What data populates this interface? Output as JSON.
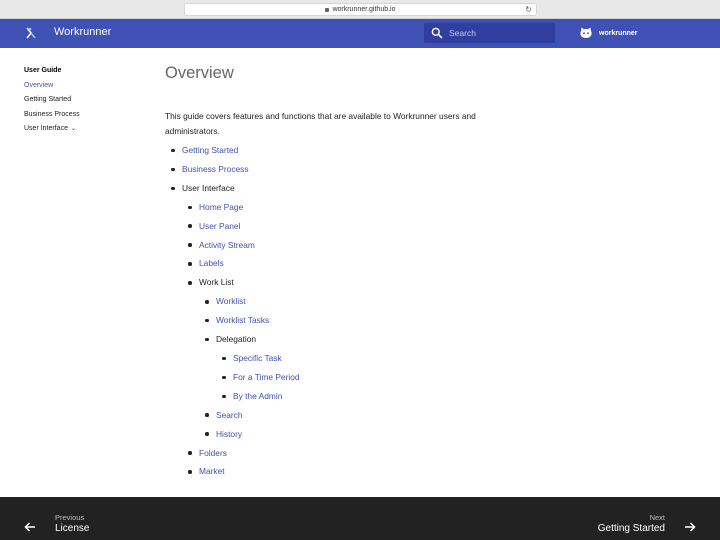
{
  "browser": {
    "url": "workrunner.github.io"
  },
  "header": {
    "title": "Workrunner",
    "search_placeholder": "Search",
    "repo_name": "workrunner",
    "icons": {
      "logo": "workrunner-logo-icon",
      "search": "search-icon",
      "repo": "github-icon"
    },
    "colors": {
      "primary": "#3f51b5",
      "search_bg": "#303f9f"
    }
  },
  "sidebar": {
    "title": "User Guide",
    "items": [
      {
        "label": "Overview",
        "active": true
      },
      {
        "label": "Getting Started"
      },
      {
        "label": "Business Process"
      },
      {
        "label": "User Interface",
        "expandable": true
      }
    ]
  },
  "main": {
    "title": "Overview",
    "intro": "This guide covers features and functions that are available to Workrunner users and administrators.",
    "tree": {
      "getting_started": "Getting Started",
      "business_process": "Business Process",
      "user_interface": "User Interface",
      "home_page": "Home Page",
      "user_panel": "User Panel",
      "activity_stream": "Activity Stream",
      "labels": "Labels",
      "work_list": "Work List",
      "worklist": "Worklist",
      "worklist_tasks": "Worklist Tasks",
      "delegation": "Delegation",
      "specific_task": "Specific Task",
      "for_a_time_period": "For a Time Period",
      "by_the_admin": "By the Admin",
      "search": "Search",
      "history": "History",
      "folders": "Folders",
      "market": "Market"
    }
  },
  "footer": {
    "previous": {
      "caption": "Previous",
      "title": "License"
    },
    "next": {
      "caption": "Next",
      "title": "Getting Started"
    },
    "colors": {
      "bg": "#222222"
    }
  }
}
